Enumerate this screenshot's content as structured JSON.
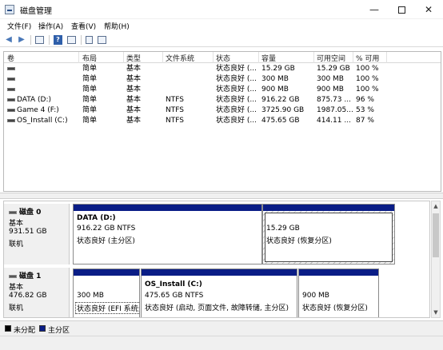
{
  "window": {
    "title": "磁盘管理",
    "minimize_label": "—",
    "close_label": "✕"
  },
  "menu": {
    "items": [
      "文件(F)",
      "操作(A)",
      "查看(V)",
      "帮助(H)"
    ]
  },
  "toolbar": {
    "icons": [
      "back-arrow-icon",
      "forward-arrow-icon",
      "console-tree-icon",
      "help-icon",
      "properties-icon",
      "view-icon"
    ]
  },
  "volume_list": {
    "columns": [
      "卷",
      "布局",
      "类型",
      "文件系统",
      "状态",
      "容量",
      "可用空间",
      "% 可用"
    ],
    "rows": [
      {
        "volume": "",
        "layout": "简单",
        "type": "基本",
        "fs": "",
        "status": "状态良好 (...",
        "capacity": "15.29 GB",
        "free": "15.29 GB",
        "pct": "100 %"
      },
      {
        "volume": "",
        "layout": "简单",
        "type": "基本",
        "fs": "",
        "status": "状态良好 (...",
        "capacity": "300 MB",
        "free": "300 MB",
        "pct": "100 %"
      },
      {
        "volume": "",
        "layout": "简单",
        "type": "基本",
        "fs": "",
        "status": "状态良好 (...",
        "capacity": "900 MB",
        "free": "900 MB",
        "pct": "100 %"
      },
      {
        "volume": "DATA (D:)",
        "layout": "简单",
        "type": "基本",
        "fs": "NTFS",
        "status": "状态良好 (...",
        "capacity": "916.22 GB",
        "free": "875.73 ...",
        "pct": "96 %"
      },
      {
        "volume": "Game 4 (F:)",
        "layout": "简单",
        "type": "基本",
        "fs": "NTFS",
        "status": "状态良好 (...",
        "capacity": "3725.90 GB",
        "free": "1987.05...",
        "pct": "53 %"
      },
      {
        "volume": "OS_Install (C:)",
        "layout": "简单",
        "type": "基本",
        "fs": "NTFS",
        "status": "状态良好 (...",
        "capacity": "475.65 GB",
        "free": "414.11 ...",
        "pct": "87 %"
      }
    ]
  },
  "disks": [
    {
      "name": "磁盘 0",
      "type": "基本",
      "size": "931.51 GB",
      "state": "联机",
      "partitions": [
        {
          "name": "DATA  (D:)",
          "size": "916.22 GB NTFS",
          "status": "状态良好 (主分区)"
        },
        {
          "name": "",
          "size": "15.29 GB",
          "status": "状态良好 (恢复分区)"
        }
      ]
    },
    {
      "name": "磁盘 1",
      "type": "基本",
      "size": "476.82 GB",
      "state": "联机",
      "partitions": [
        {
          "name": "",
          "size": "300 MB",
          "status": "状态良好 (EFI 系统分区)"
        },
        {
          "name": "OS_Install  (C:)",
          "size": "475.65 GB NTFS",
          "status": "状态良好 (启动, 页面文件, 故障转储, 主分区)"
        },
        {
          "name": "",
          "size": "900 MB",
          "status": "状态良好 (恢复分区)"
        }
      ]
    }
  ],
  "legend": {
    "unallocated": "未分配",
    "primary": "主分区",
    "unallocated_color": "#000000",
    "primary_color": "#0a1d86"
  }
}
